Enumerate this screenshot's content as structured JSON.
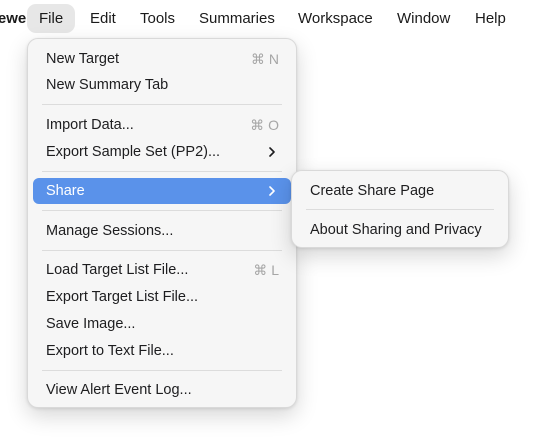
{
  "menubar": {
    "app_name": "Viewer",
    "items": [
      "File",
      "Edit",
      "Tools",
      "Summaries",
      "Workspace",
      "Window",
      "Help"
    ]
  },
  "file_menu": {
    "new_target": {
      "label": "New Target",
      "shortcut": "⌘ N"
    },
    "new_summary_tab": {
      "label": "New Summary Tab"
    },
    "import_data": {
      "label": "Import Data...",
      "shortcut": "⌘ O"
    },
    "export_sample_set": {
      "label": "Export Sample Set (PP2)..."
    },
    "share": {
      "label": "Share"
    },
    "manage_sessions": {
      "label": "Manage Sessions..."
    },
    "load_target_list": {
      "label": "Load Target List File...",
      "shortcut": "⌘ L"
    },
    "export_target_list": {
      "label": "Export Target List File..."
    },
    "save_image": {
      "label": "Save Image..."
    },
    "export_text": {
      "label": "Export to Text File..."
    },
    "view_alert_log": {
      "label": "View Alert Event Log..."
    }
  },
  "share_submenu": {
    "create_share_page": "Create Share Page",
    "about_sharing": "About Sharing and Privacy"
  },
  "colors": {
    "highlight": "#5a92ea",
    "menu_background": "#f6f6f6",
    "shortcut_text": "#a6a6a6"
  },
  "icons": {
    "submenu_indicator": "chevron-right-icon"
  }
}
